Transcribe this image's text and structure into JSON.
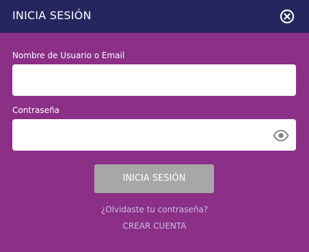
{
  "header": {
    "title": "INICIA SESIÓN",
    "close_icon": "close-circle-icon"
  },
  "form": {
    "username": {
      "label": "Nombre de Usuario o Email",
      "value": "",
      "placeholder": ""
    },
    "password": {
      "label": "Contraseña",
      "value": "",
      "placeholder": "",
      "toggle_icon": "eye-icon"
    },
    "submit_label": "INICIA SESIÓN"
  },
  "links": {
    "forgot_password": "¿Olvidaste tu contraseña?",
    "create_account": "CREAR CUENTA"
  },
  "colors": {
    "background": "#8b2f87",
    "header": "#25265f",
    "button_disabled": "#a9a6a8",
    "link": "#c9bfe0"
  }
}
